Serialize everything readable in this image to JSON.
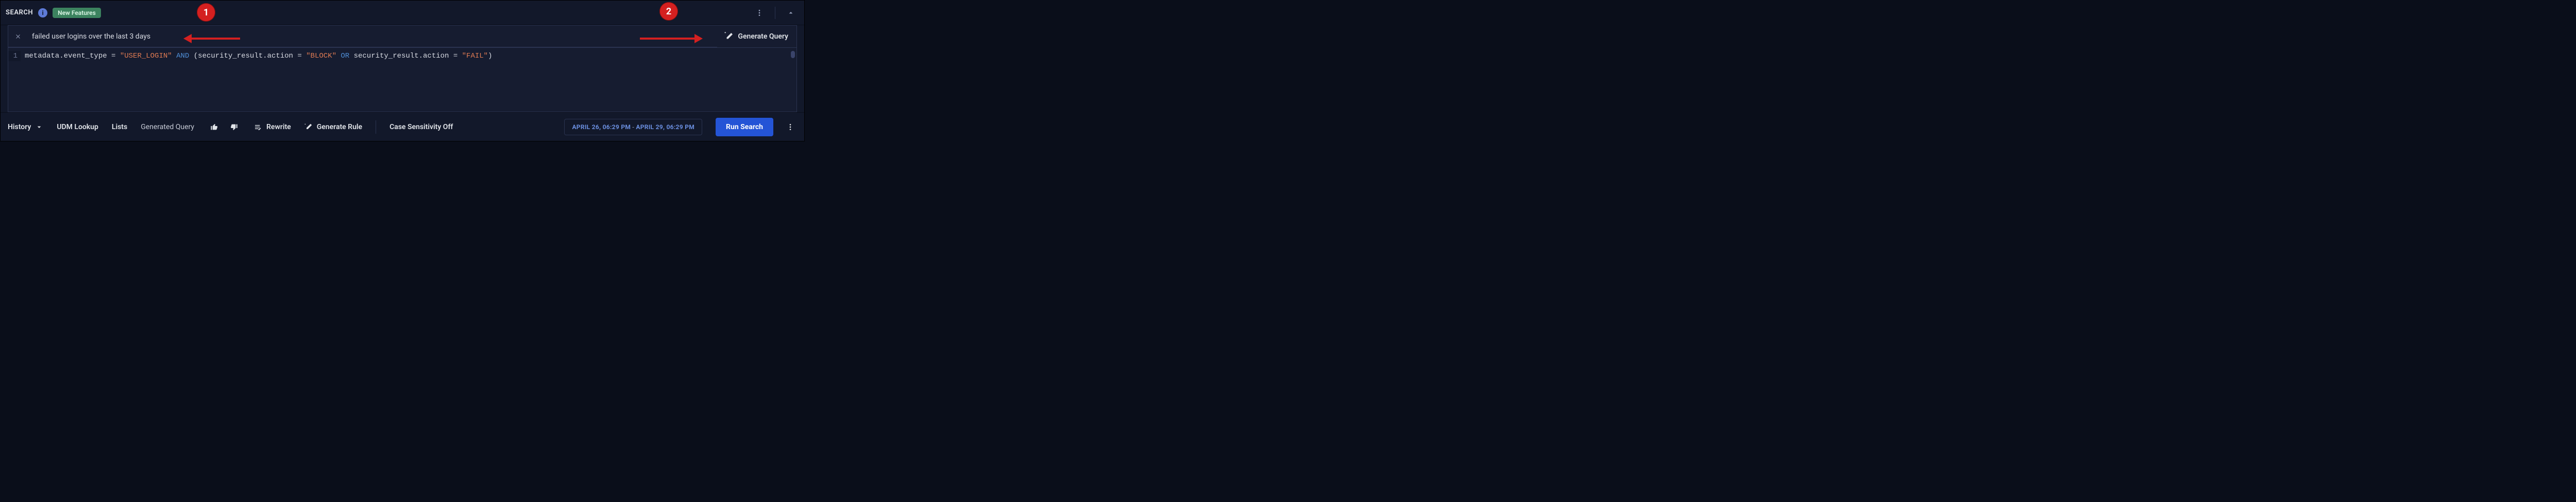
{
  "header": {
    "title": "SEARCH",
    "new_features_label": "New Features"
  },
  "nl_prompt": {
    "text": "failed user logins over the last 3 days",
    "generate_button_label": "Generate Query"
  },
  "editor": {
    "line_number": "1",
    "tokens": [
      {
        "cls": "tk-op",
        "t": "metadata.event_type "
      },
      {
        "cls": "tk-op",
        "t": "= "
      },
      {
        "cls": "tk-str",
        "t": "\"USER_LOGIN\""
      },
      {
        "cls": "tk-op",
        "t": " "
      },
      {
        "cls": "tk-kw",
        "t": "AND"
      },
      {
        "cls": "tk-op",
        "t": " (security_result.action "
      },
      {
        "cls": "tk-op",
        "t": "= "
      },
      {
        "cls": "tk-str",
        "t": "\"BLOCK\""
      },
      {
        "cls": "tk-op",
        "t": " "
      },
      {
        "cls": "tk-kw",
        "t": "OR"
      },
      {
        "cls": "tk-op",
        "t": " security_result.action "
      },
      {
        "cls": "tk-op",
        "t": "= "
      },
      {
        "cls": "tk-str",
        "t": "\"FAIL\""
      },
      {
        "cls": "tk-op",
        "t": ")"
      }
    ]
  },
  "toolbar": {
    "history_label": "History",
    "udm_lookup_label": "UDM Lookup",
    "lists_label": "Lists",
    "generated_query_label": "Generated Query",
    "rewrite_label": "Rewrite",
    "generate_rule_label": "Generate Rule",
    "case_sensitivity_label": "Case Sensitivity Off",
    "date_range": {
      "from": "APRIL 26, 06:29 PM",
      "sep": " - ",
      "to": "APRIL 29, 06:29 PM"
    },
    "run_search_label": "Run Search"
  },
  "annotations": {
    "circle1": "1",
    "circle2": "2"
  }
}
